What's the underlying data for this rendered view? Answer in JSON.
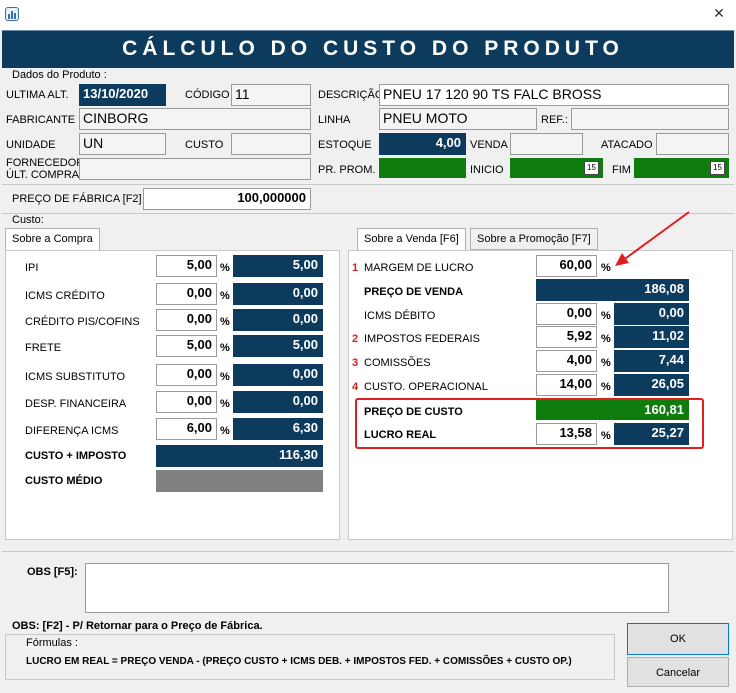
{
  "window": {
    "title_banner": "CÁLCULO DO CUSTO DO PRODUTO",
    "close_glyph": "✕",
    "icon": "chart-icon"
  },
  "dados_produto": {
    "group_label": "Dados do Produto :",
    "ultima_alt_label": "ULTIMA ALT.",
    "ultima_alt_value": "13/10/2020",
    "codigo_label": "CÓDIGO",
    "codigo_value": "11",
    "descricao_label": "DESCRIÇÃO",
    "descricao_value": "PNEU 17 120 90 TS FALC BROSS",
    "fabricante_label": "FABRICANTE",
    "fabricante_value": "CINBORG",
    "linha_label": "LINHA",
    "linha_value": "PNEU MOTO",
    "ref_label": "REF.:",
    "ref_value": "",
    "unidade_label": "UNIDADE",
    "unidade_value": "UN",
    "custo_label": "CUSTO",
    "custo_value": "",
    "estoque_label": "ESTOQUE",
    "estoque_value": "4,00",
    "venda_label": "VENDA",
    "venda_value": "",
    "atacado_label": "ATACADO",
    "atacado_value": "",
    "fornecedor_label_1": "FORNECEDOR",
    "fornecedor_label_2": "ÚLT. COMPRA",
    "fornecedor_value": "",
    "pr_prom_label": "PR. PROM.",
    "inicio_label": "INICIO",
    "fim_label": "FIM",
    "calendar_glyph": "15"
  },
  "preco_fabrica": {
    "label": "PREÇO DE FÁBRICA [F2]",
    "value": "100,000000"
  },
  "custo": {
    "group_label": "Custo:",
    "tab_label": "Sobre a Compra",
    "pct_symbol": "%",
    "rows": [
      {
        "label": "IPI",
        "pct": "5,00",
        "value": "5,00"
      },
      {
        "label": "ICMS CRÉDITO",
        "pct": "0,00",
        "value": "0,00"
      },
      {
        "label": "CRÉDITO PIS/COFINS",
        "pct": "0,00",
        "value": "0,00"
      },
      {
        "label": "FRETE",
        "pct": "5,00",
        "value": "5,00"
      },
      {
        "label": "ICMS SUBSTITUTO",
        "pct": "0,00",
        "value": "0,00"
      },
      {
        "label": "DESP. FINANCEIRA",
        "pct": "0,00",
        "value": "0,00"
      },
      {
        "label": "DIFERENÇA ICMS",
        "pct": "6,00",
        "value": "6,30"
      }
    ],
    "custo_imposto_label": "CUSTO + IMPOSTO",
    "custo_imposto_value": "116,30",
    "custo_medio_label": "CUSTO MÉDIO",
    "custo_medio_value": ""
  },
  "venda": {
    "tab_venda": "Sobre a Venda [F6]",
    "tab_promo": "Sobre a Promoção [F7]",
    "margem_num": "1",
    "margem_label": "MARGEM DE LUCRO",
    "margem_pct": "60,00",
    "preco_venda_label": "PREÇO DE VENDA",
    "preco_venda_value": "186,08",
    "icms_debito_label": "ICMS DÉBITO",
    "icms_debito_pct": "0,00",
    "icms_debito_value": "0,00",
    "impostos_num": "2",
    "impostos_label": "IMPOSTOS FEDERAIS",
    "impostos_pct": "5,92",
    "impostos_value": "11,02",
    "comissoes_num": "3",
    "comissoes_label": "COMISSÕES",
    "comissoes_pct": "4,00",
    "comissoes_value": "7,44",
    "custo_op_num": "4",
    "custo_op_label": "CUSTO. OPERACIONAL",
    "custo_op_pct": "14,00",
    "custo_op_value": "26,05",
    "preco_custo_label": "PREÇO DE CUSTO",
    "preco_custo_value": "160,81",
    "lucro_real_label": "LUCRO REAL",
    "lucro_real_pct": "13,58",
    "lucro_real_value": "25,27",
    "highlight_color": "#e02020"
  },
  "obs": {
    "label": "OBS [F5]:",
    "value": "",
    "hint": "OBS:   [F2] - P/ Retornar para o Preço de Fábrica.",
    "formulas_label": "Fórmulas :",
    "formula": "LUCRO EM REAL = PREÇO VENDA - (PREÇO CUSTO + ICMS DEB. + IMPOSTOS FED. + COMISSÕES + CUSTO OP.)"
  },
  "buttons": {
    "ok": "OK",
    "cancel": "Cancelar"
  },
  "colors": {
    "banner": "#0d3b5e",
    "dark_field": "#0d3b5e",
    "green_field": "#0e7d0e",
    "accent_red": "#d62020"
  }
}
